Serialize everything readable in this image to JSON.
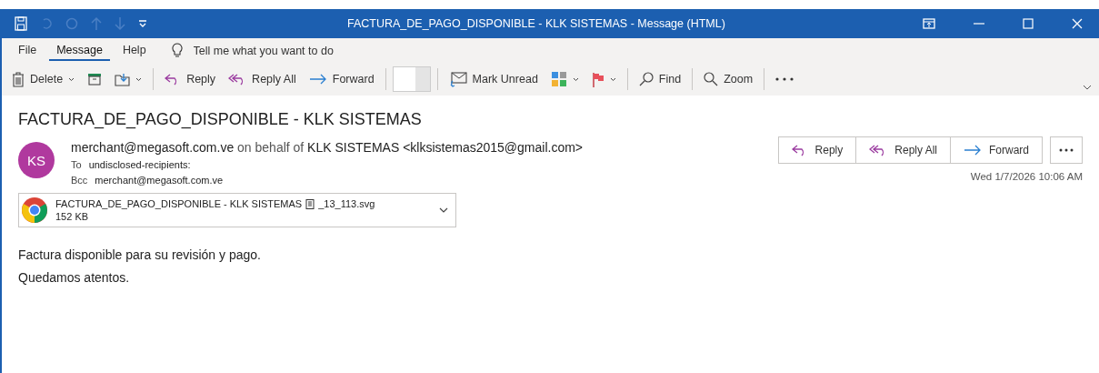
{
  "window": {
    "title": "FACTURA_DE_PAGO_DISPONIBLE - KLK SISTEMAS  -  Message (HTML)"
  },
  "tabs": [
    {
      "label": "File",
      "selected": false
    },
    {
      "label": "Message",
      "selected": true
    },
    {
      "label": "Help",
      "selected": false
    }
  ],
  "tell_me": {
    "placeholder": "Tell me what you want to do"
  },
  "toolbar": [
    {
      "kind": "delete",
      "label": "Delete"
    },
    {
      "kind": "archive"
    },
    {
      "kind": "move"
    },
    {
      "kind": "sep"
    },
    {
      "kind": "reply",
      "label": "Reply"
    },
    {
      "kind": "replyall",
      "label": "Reply All"
    },
    {
      "kind": "forward",
      "label": "Forward"
    },
    {
      "kind": "sep"
    },
    {
      "kind": "blank"
    },
    {
      "kind": "sep"
    },
    {
      "kind": "unread",
      "label": "Mark Unread"
    },
    {
      "kind": "categorize"
    },
    {
      "kind": "flag"
    },
    {
      "kind": "sep"
    },
    {
      "kind": "find",
      "label": "Find"
    },
    {
      "kind": "sep"
    },
    {
      "kind": "zoom",
      "label": "Zoom"
    },
    {
      "kind": "sep"
    },
    {
      "kind": "more"
    }
  ],
  "message": {
    "subject": "FACTURA_DE_PAGO_DISPONIBLE - KLK SISTEMAS",
    "avatar_initials": "KS",
    "from": "merchant@megasoft.com.ve",
    "on_behalf": "on behalf of",
    "sender": "KLK SISTEMAS <klksistemas2015@gmail.com>",
    "to_label": "To",
    "to": "undisclosed-recipients:",
    "bcc_label": "Bcc",
    "bcc": "merchant@megasoft.com.ve",
    "actions": [
      {
        "kind": "reply",
        "label": "Reply"
      },
      {
        "kind": "replyall",
        "label": "Reply All"
      },
      {
        "kind": "forward",
        "label": "Forward"
      }
    ],
    "date": "Wed 1/7/2026 10:06 AM",
    "attachment": {
      "name_start": "FACTURA_DE_PAGO_DISPONIBLE - KLK SISTEMAS",
      "name_end": "_13_113.svg",
      "size": "152 KB"
    },
    "body": [
      "Factura disponible para su revisión y pago.",
      "Quedamos atentos."
    ]
  }
}
